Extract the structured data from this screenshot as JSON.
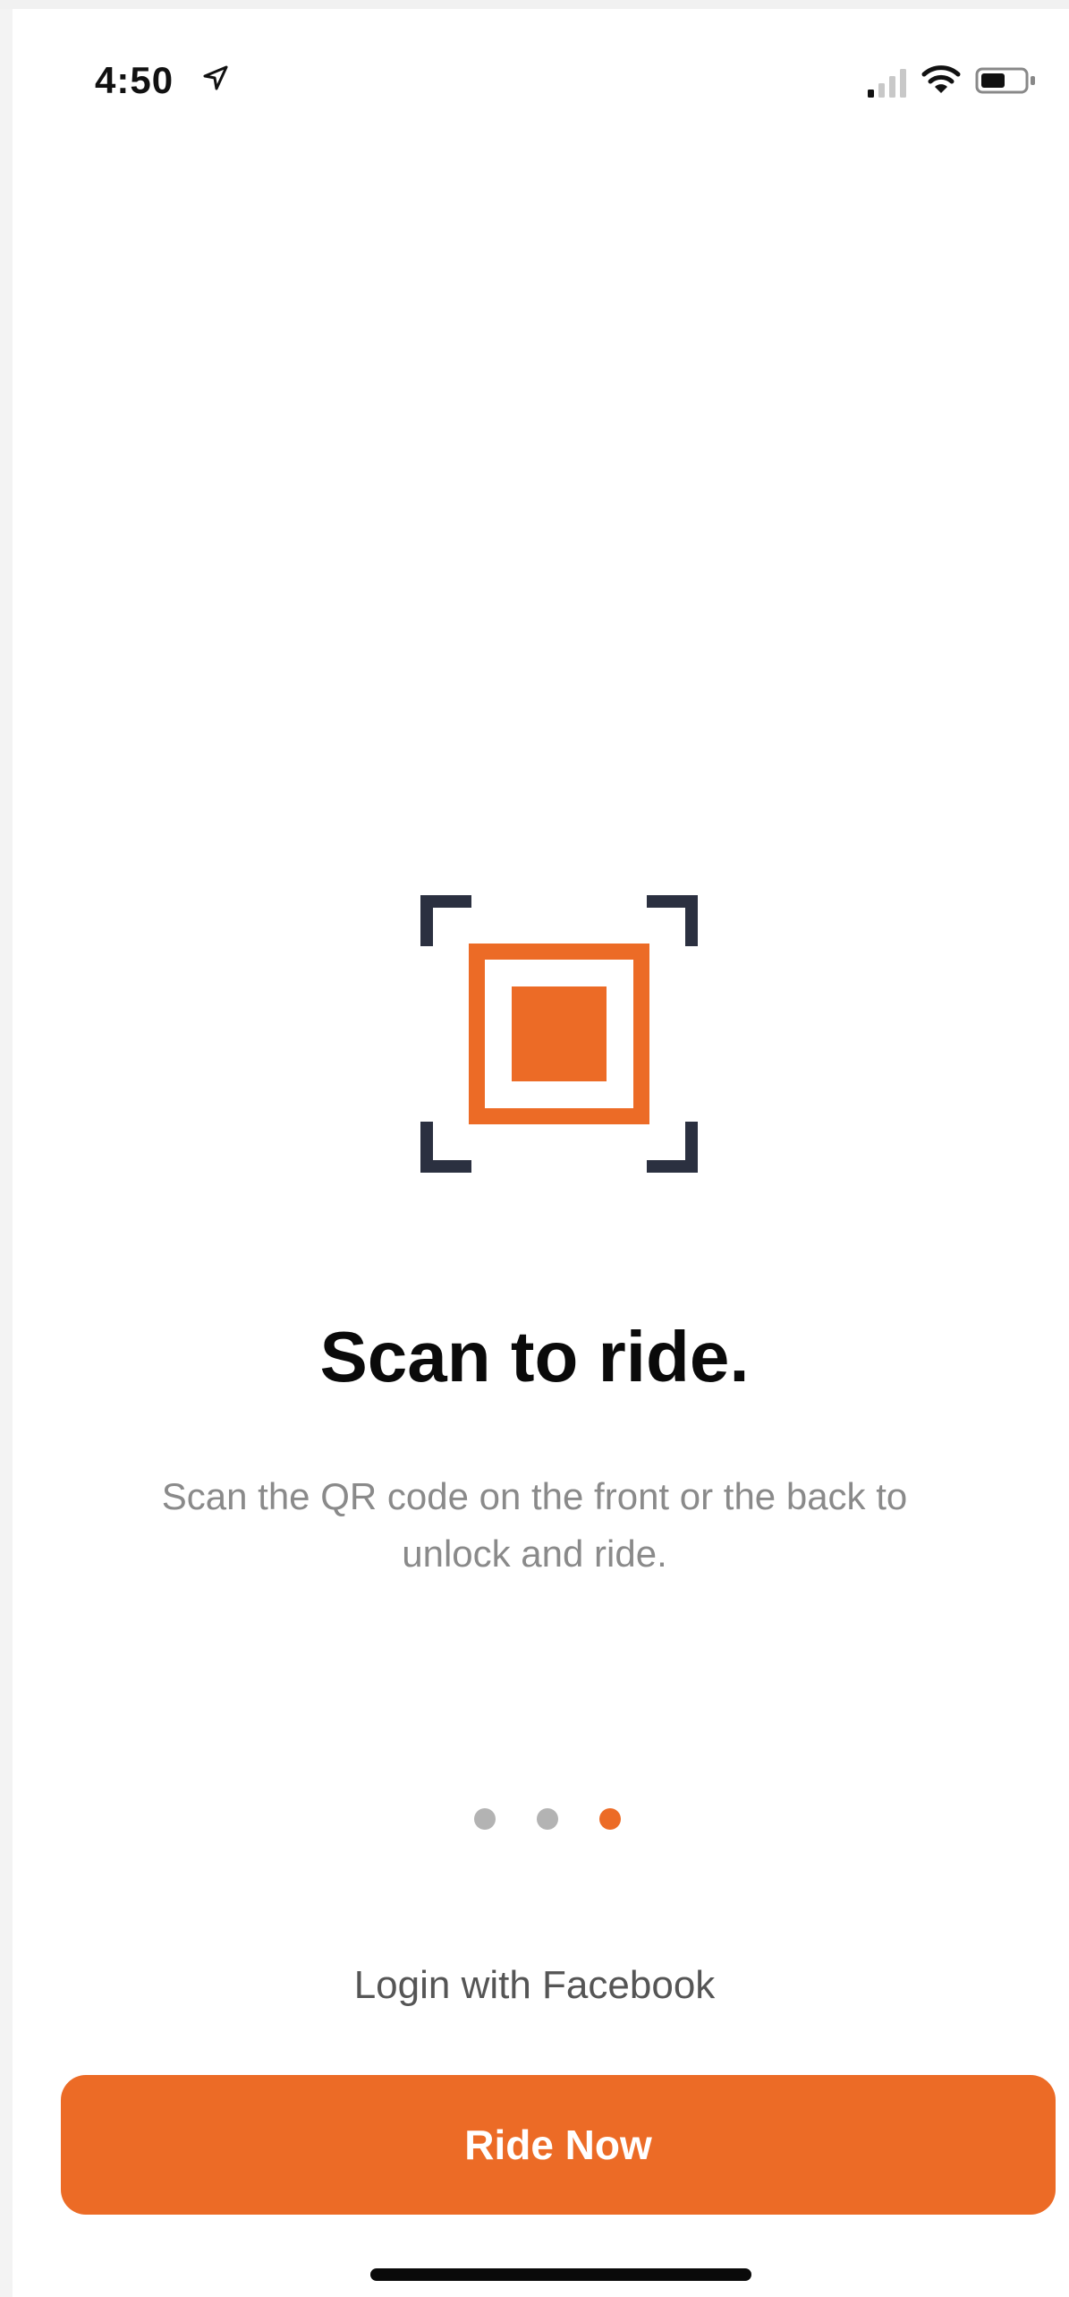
{
  "status_bar": {
    "time": "4:50",
    "icons": [
      "location-arrow-icon",
      "cellular-signal-icon",
      "wifi-icon",
      "battery-icon"
    ]
  },
  "onboarding": {
    "illustration_icon": "qr-scan-icon",
    "title": "Scan to ride.",
    "description": "Scan the QR code on the front or the back to unlock and ride.",
    "pager": {
      "total": 3,
      "active_index": 2
    }
  },
  "actions": {
    "facebook_login_label": "Login with Facebook",
    "ride_now_label": "Ride Now"
  },
  "colors": {
    "accent": "#ec6b26",
    "frame_dark": "#2b3040",
    "text_primary": "#0a0a0a",
    "text_secondary": "#8a8a8a",
    "dot_inactive": "#b3b3b3"
  }
}
